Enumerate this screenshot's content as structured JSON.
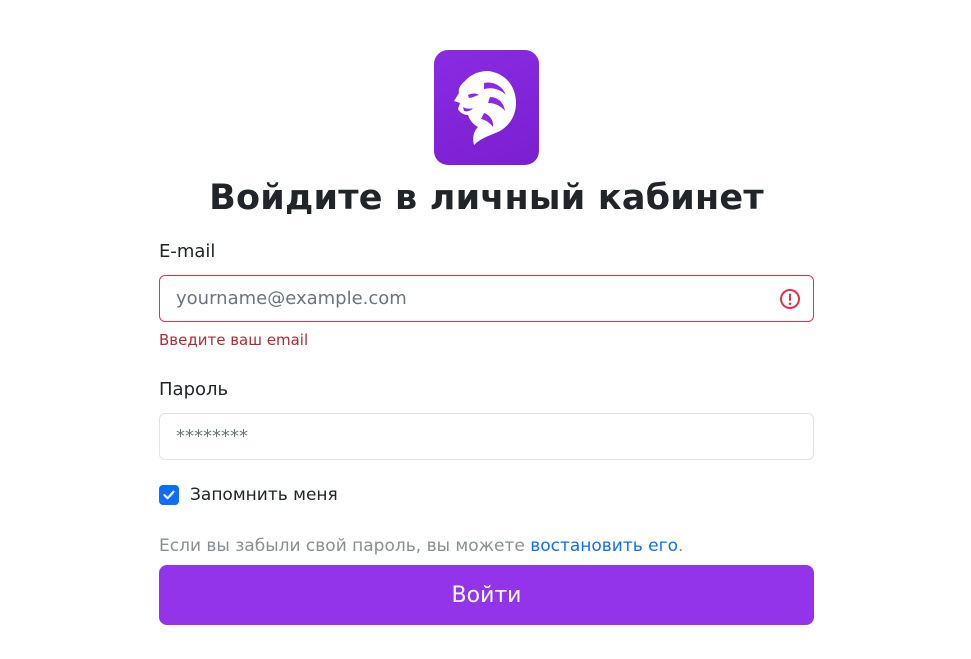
{
  "page": {
    "title": "Войдите в личный кабинет"
  },
  "form": {
    "email_label": "E-mail",
    "email_placeholder": "yourname@example.com",
    "email_value": "",
    "email_error": "Введите ваш email",
    "password_label": "Пароль",
    "password_placeholder": "********",
    "remember_label": "Запомнить меня",
    "remember_checked": true,
    "hint_text": "Если вы забыли свой пароль, вы можете ",
    "hint_link": "востановить его",
    "hint_end": ".",
    "submit_label": "Войти"
  },
  "icons": {
    "logo": "lion-logo-icon",
    "invalid": "exclamation-circle-icon",
    "check": "checkmark-icon"
  },
  "colors": {
    "brand": "#9333ea",
    "logo_bg": "#8a2be2",
    "error": "#dc3545",
    "link": "#0d6efd"
  }
}
